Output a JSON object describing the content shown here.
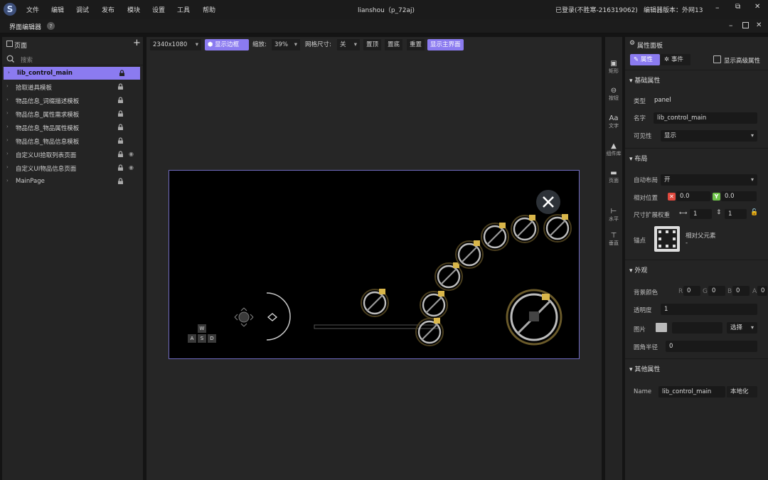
{
  "app": {
    "title": "lianshou（p_72aj)",
    "login_status": "已登录(不胜寒-216319062)",
    "editor_version": "编辑器版本：外网13"
  },
  "menu": [
    "文件",
    "编辑",
    "调试",
    "发布",
    "模块",
    "设置",
    "工具",
    "帮助"
  ],
  "editor": {
    "title": "界面编辑器",
    "help": "?"
  },
  "window_icons": [
    "minimize-icon",
    "restore-icon",
    "close-icon"
  ],
  "left": {
    "title": "页面",
    "add": "+",
    "search_placeholder": "搜索",
    "items": [
      {
        "label": "lib_control_main",
        "selected": true,
        "eye": false
      },
      {
        "label": "拾取道具模板",
        "selected": false,
        "eye": false
      },
      {
        "label": "物品信息_词缀描述模板",
        "selected": false,
        "eye": false
      },
      {
        "label": "物品信息_属性需求模板",
        "selected": false,
        "eye": false
      },
      {
        "label": "物品信息_物品属性模板",
        "selected": false,
        "eye": false
      },
      {
        "label": "物品信息_物品信息模板",
        "selected": false,
        "eye": false
      },
      {
        "label": "自定义UI拾取列表页面",
        "selected": false,
        "eye": true
      },
      {
        "label": "自定义UI物品信息页面",
        "selected": false,
        "eye": true
      },
      {
        "label": "MainPage",
        "selected": false,
        "eye": false
      }
    ]
  },
  "toolbar": {
    "resolution": "2340x1080",
    "show_border": "显示边框",
    "zoom_label": "缩放:",
    "zoom_value": "39%",
    "grid_label": "网格尺寸:",
    "grid_value": "关",
    "top": "置顶",
    "bottom": "置底",
    "reset": "重置",
    "show_main": "显示主界面"
  },
  "canvas": {
    "keys": [
      "W",
      "A",
      "S",
      "D"
    ]
  },
  "rail": [
    "矩形",
    "按钮",
    "文字",
    "组件库",
    "页面",
    "水平",
    "垂直"
  ],
  "right": {
    "title": "属性面板",
    "tab_props": "属性",
    "tab_events": "事件",
    "advanced": "显示高级属性",
    "basic": "基础属性",
    "type_label": "类型",
    "type_value": "panel",
    "name_label": "名字",
    "name_value": "lib_control_main",
    "visible_label": "可见性",
    "visible_value": "显示",
    "layout": "布局",
    "auto_layout_label": "自动布局",
    "auto_layout_value": "开",
    "rel_pos_label": "相对位置",
    "x_value": "0.0",
    "y_value": "0.0",
    "expand_label": "尺寸扩展权重",
    "w_value": "1",
    "h_value": "1",
    "anchor_label": "锚点",
    "anchor_text": "相对父元素",
    "anchor_sub": "-",
    "appearance": "外观",
    "bg_color_label": "背景颜色",
    "r": "0",
    "g": "0",
    "b": "0",
    "a": "0",
    "opacity_label": "透明度",
    "opacity_value": "1",
    "image_label": "图片",
    "choose": "选择",
    "radius_label": "圆角半径",
    "radius_value": "0",
    "other": "其他属性",
    "name2_label": "Name",
    "name2_value": "lib_control_main",
    "localize": "本地化"
  },
  "colors": {
    "accent": "#8b7bf0",
    "selected_row": "#8b7bf0",
    "red": "#e0493e",
    "green": "#6fc34a"
  }
}
